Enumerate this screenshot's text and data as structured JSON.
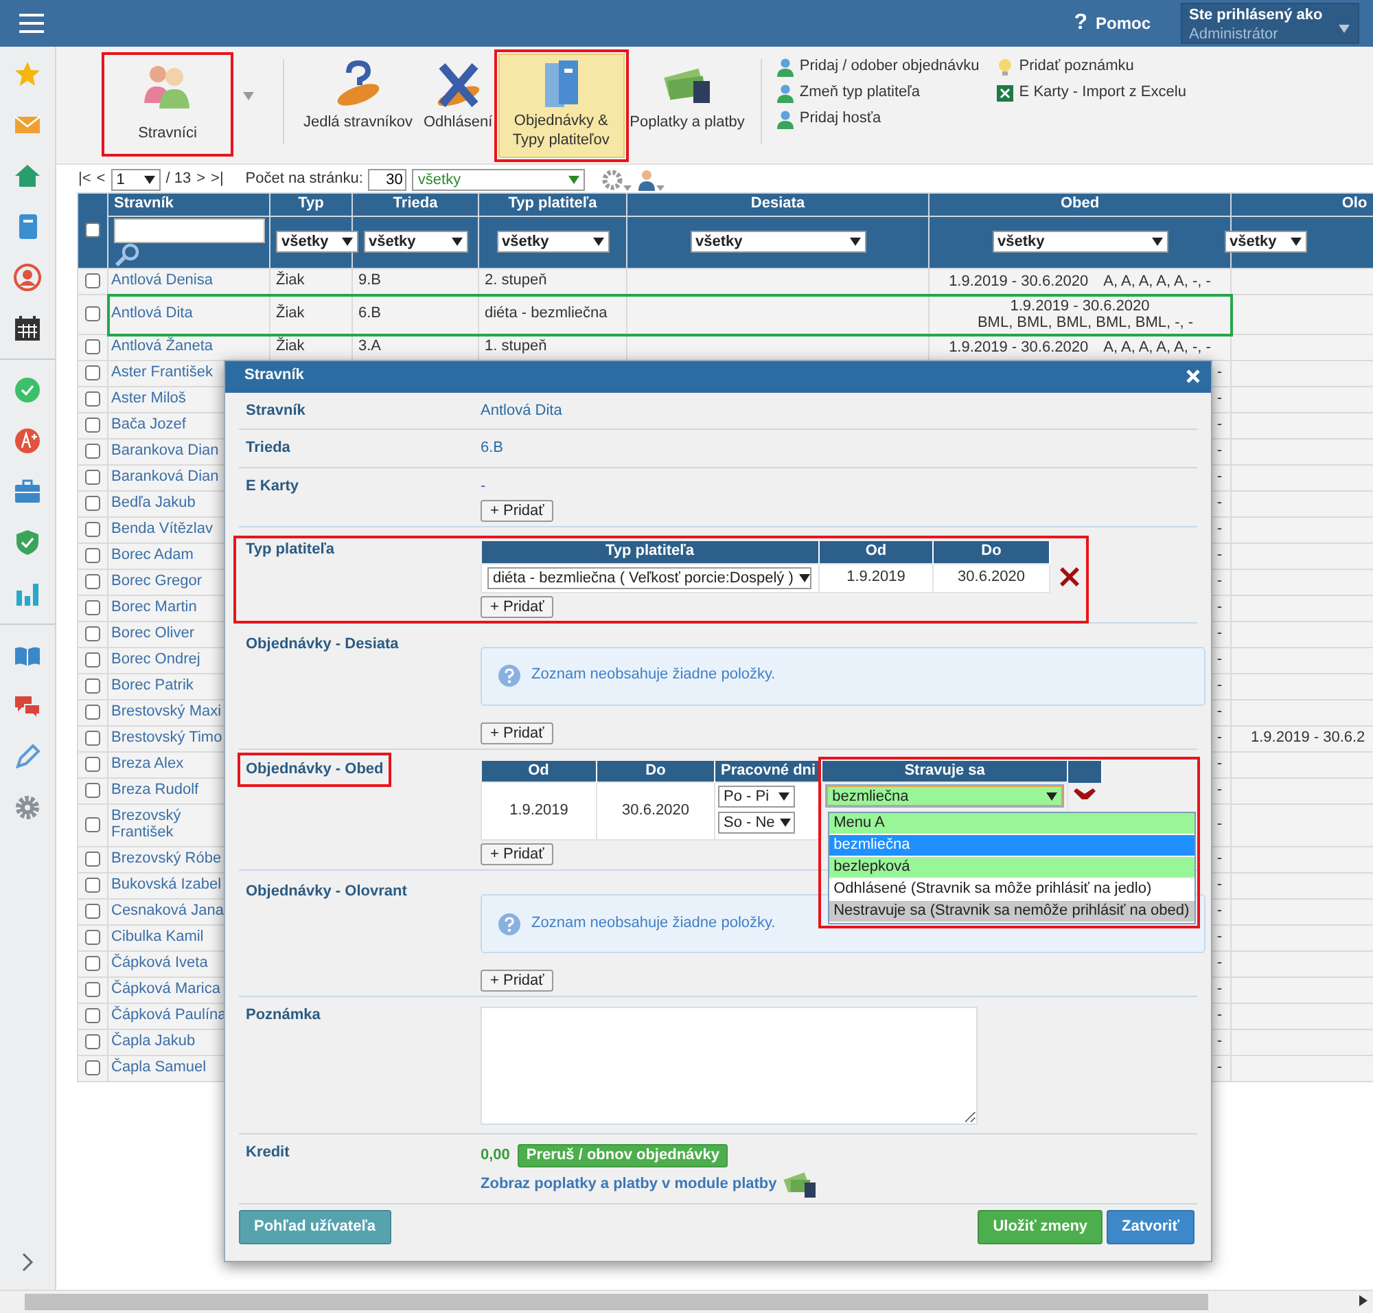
{
  "navbar": {
    "help_mark": "?",
    "help": "Pomoc",
    "user_label": "Ste prihlásený ako",
    "user_name": "Administrátor"
  },
  "toolbar": {
    "buttons": [
      {
        "label": "Stravníci",
        "kind": "people",
        "dropdown": true,
        "selected": false,
        "highlighted": true
      },
      {
        "label": "Jedlá stravníkov",
        "kind": "bread",
        "dropdown": false,
        "selected": false,
        "highlighted": false
      },
      {
        "label": "Odhlásení",
        "kind": "cross",
        "dropdown": false,
        "selected": false,
        "highlighted": false
      },
      {
        "label": "Objednávky & Typy platiteľov",
        "kind": "binder",
        "dropdown": false,
        "selected": true,
        "highlighted": true
      },
      {
        "label": "Poplatky a platby",
        "kind": "money",
        "dropdown": false,
        "selected": false,
        "highlighted": false
      }
    ],
    "links": [
      {
        "label": "Pridaj / odober objednávku",
        "kind": "user"
      },
      {
        "label": "Zmeň typ platiteľa",
        "kind": "user"
      },
      {
        "label": "Pridaj hosťa",
        "kind": "user"
      },
      {
        "label": "Pridať poznámku",
        "kind": "bulb"
      },
      {
        "label": "E Karty - Import z Excelu",
        "kind": "excel"
      }
    ]
  },
  "pager": {
    "first": "|<",
    "prev": "<",
    "page": "1",
    "total": "/ 13",
    "next": ">",
    "last": ">|",
    "per_page_label": "Počet na stránku:",
    "per_page": "30",
    "filter": "všetky"
  },
  "table": {
    "select_all_checked": false,
    "columns": [
      "Stravník",
      "Typ",
      "Trieda",
      "Typ platiteľa",
      "Desiata",
      "Obed",
      "Olo"
    ],
    "filters": [
      "všetky",
      "všetky",
      "všetky",
      "všetky",
      "všetky",
      "všetky"
    ],
    "rows": [
      {
        "name": "Antlová Denisa",
        "type": "Žiak",
        "class": "9.B",
        "payer": "2. stupeň",
        "obed_dates": "1.9.2019 - 30.6.2020",
        "obed_meals": "A, A, A, A, A, -, -",
        "checked": false,
        "highlighted": false
      },
      {
        "name": "Antlová Dita",
        "type": "Žiak",
        "class": "6.B",
        "payer": "diéta - bezmliečna",
        "obed_dates": "1.9.2019 - 30.6.2020",
        "obed_meals": "BML, BML, BML, BML, BML, -, -",
        "checked": false,
        "highlighted": true
      },
      {
        "name": "Antlová Žaneta",
        "type": "Žiak",
        "class": "3.A",
        "payer": "1. stupeň",
        "obed_dates": "1.9.2019 - 30.6.2020",
        "obed_meals": "A, A, A, A, A, -, -",
        "checked": false,
        "highlighted": false
      },
      {
        "name": "Aster František",
        "obed_tail": "-",
        "checked": false
      },
      {
        "name": "Aster Miloš",
        "obed_tail": "-",
        "checked": false
      },
      {
        "name": "Bača Jozef",
        "obed_tail": "-",
        "checked": false
      },
      {
        "name": "Barankova Dian",
        "obed_tail": "-",
        "checked": false
      },
      {
        "name": "Baranková Dian",
        "obed_tail": "-",
        "checked": false
      },
      {
        "name": "Bedľa Jakub",
        "obed_tail": "-",
        "checked": false
      },
      {
        "name": "Benda Vítězlav",
        "obed_tail": "-",
        "checked": false
      },
      {
        "name": "Borec Adam",
        "obed_tail": "-",
        "checked": false
      },
      {
        "name": "Borec Gregor",
        "obed_tail": "-",
        "checked": false
      },
      {
        "name": "Borec Martin",
        "obed_tail": "-",
        "checked": false
      },
      {
        "name": "Borec Oliver",
        "obed_tail": "-",
        "checked": false
      },
      {
        "name": "Borec Ondrej",
        "obed_tail": "-",
        "checked": false
      },
      {
        "name": "Borec Patrik",
        "obed_tail": "-",
        "checked": false
      },
      {
        "name": "Brestovský Maxi",
        "obed_tail": "-",
        "checked": false
      },
      {
        "name": "Brestovský Timo",
        "obed_tail": "-",
        "olo": "1.9.2019 - 30.6.2",
        "checked": false
      },
      {
        "name": "Breza Alex",
        "obed_tail": "-",
        "checked": false
      },
      {
        "name": "Breza Rudolf",
        "obed_tail": "-",
        "checked": false
      },
      {
        "name": "Brezovský František",
        "obed_tail": "-",
        "checked": false
      },
      {
        "name": "Brezovský Róbe",
        "obed_tail": "-",
        "checked": false
      },
      {
        "name": "Bukovská Izabel",
        "obed_tail": "-",
        "checked": false
      },
      {
        "name": "Cesnaková Jana",
        "obed_tail": "-",
        "checked": false
      },
      {
        "name": "Cibulka Kamil",
        "obed_tail": "-",
        "checked": false
      },
      {
        "name": "Čápková Iveta",
        "obed_tail": "-",
        "checked": false
      },
      {
        "name": "Čápková Marica",
        "obed_tail": "-",
        "checked": false
      },
      {
        "name": "Čápková Paulína",
        "obed_tail": "-",
        "checked": false
      },
      {
        "name": "Čapla Jakub",
        "obed_tail": "-",
        "checked": false
      },
      {
        "name": "Čapla Samuel",
        "obed_tail": "-",
        "checked": false
      }
    ]
  },
  "modal": {
    "title": "Stravník",
    "fields": [
      {
        "label": "Stravník",
        "value": "Antlová Dita"
      },
      {
        "label": "Trieda",
        "value": "6.B"
      },
      {
        "label": "E Karty",
        "value": "-",
        "add": "+ Pridať"
      }
    ],
    "payer": {
      "label": "Typ platiteľa",
      "highlighted": true,
      "columns": [
        "Typ platiteľa",
        "Od",
        "Do"
      ],
      "rows": [
        {
          "type": "diéta - bezmliečna ( Veľkosť porcie:Dospelý )",
          "from": "1.9.2019",
          "to": "30.6.2020"
        }
      ],
      "add": "+ Pridať"
    },
    "orders": [
      {
        "label": "Objednávky - Desiata",
        "kind": "empty",
        "highlighted": false,
        "empty": "Zoznam neobsahuje žiadne položky.",
        "add": "+ Pridať"
      },
      {
        "label": "Objednávky - Obed",
        "kind": "table",
        "highlighted": true,
        "columns": [
          "Od",
          "Do",
          "Pracovné dni",
          "Stravuje sa"
        ],
        "rows": [
          {
            "from": "1.9.2019",
            "to": "30.6.2020",
            "days": [
              "Po - Pi",
              "So - Ne"
            ],
            "meal": "bezmliečna",
            "expanded": true,
            "menu_highlighted": true,
            "options": [
              {
                "label": "Menu A",
                "color": "#98f598",
                "selected": false
              },
              {
                "label": "bezmliečna",
                "color": "#1e90ff",
                "selected": true
              },
              {
                "label": "bezlepková",
                "color": "#98f598",
                "selected": false
              },
              {
                "label": "Odhlásené (Stravnik sa môže prihlásiť na jedlo)",
                "color": "#ffffff",
                "selected": false
              },
              {
                "label": "Nestravuje sa (Stravnik sa nemôže prihlásiť na obed)",
                "color": "#c8c8c8",
                "selected": false
              }
            ]
          }
        ],
        "add": "+ Pridať"
      },
      {
        "label": "Objednávky - Olovrant",
        "kind": "empty",
        "highlighted": false,
        "empty": "Zoznam neobsahuje žiadne položky.",
        "add": "+ Pridať"
      }
    ],
    "note": {
      "label": "Poznámka"
    },
    "credit": {
      "label": "Kredit",
      "amount": "0,00",
      "toggle": "Preruš / obnov objednávky",
      "link": "Zobraz poplatky a platby v module platby"
    },
    "footer": {
      "user_view": "Pohľad užívateľa",
      "save": "Uložiť zmeny",
      "close": "Zatvoriť"
    }
  }
}
